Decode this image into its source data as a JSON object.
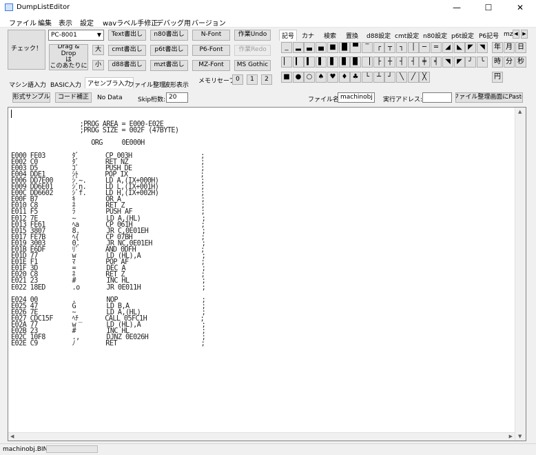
{
  "window": {
    "title": "DumpListEditor",
    "minimize": "—",
    "maximize": "☐",
    "close": "✕"
  },
  "menu": [
    "ファイル",
    "編集",
    "表示",
    "設定",
    "wavラベル手修正",
    "デバッグ用",
    "バージョン"
  ],
  "toolbar": {
    "check": "チェック！",
    "machine_select": "PC-8001",
    "drag_drop": "Drag & Drop\nは\nこのあたりに",
    "size_large": "大",
    "size_small": "小",
    "text_out": "Text書出し",
    "cmt_out": "cmt書出し",
    "d88_out": "d88書出し",
    "n80_out": "n80書出し",
    "p6t_out": "p6t書出し",
    "mzt_out": "mzt書出し",
    "n_font": "N-Font",
    "p6_font": "P6-Font",
    "mz_font": "MZ-Font",
    "undo": "作業Undo",
    "redo": "作業Redo",
    "ms_gothic": "MS Gothic"
  },
  "left_tabs": [
    "マシン語入力",
    "BASIC入力",
    "アセンブラ入力",
    "ファイル整理",
    "波形表示"
  ],
  "active_left_tab": "アセンブラ入力",
  "memory_save": {
    "label": "メモリセーブ:",
    "slots": [
      "0",
      "1",
      "2"
    ]
  },
  "right_tabs": [
    "記号",
    "カナ",
    "検索",
    "置換",
    "d88設定",
    "cmt設定",
    "n80設定",
    "p6t設定",
    "P6記号",
    "mz"
  ],
  "active_right_tab": "記号",
  "symbol_rows": [
    [
      "_",
      "▂",
      "▃",
      "▄",
      "■",
      "█",
      "▀",
      "‾",
      "┌",
      "┬",
      "┐",
      "│",
      "─",
      "═",
      "◢",
      "◣",
      "◤",
      "◥"
    ],
    [
      "▏",
      "▎",
      "▍",
      "▌",
      "▋",
      "▊",
      "▉",
      "▕",
      "├",
      "┼",
      "┤",
      "┤",
      "╪",
      "╡",
      "◥",
      "◤",
      "╯",
      "╰"
    ],
    [
      "■",
      "●",
      "○",
      "♠",
      "♥",
      "♦",
      "♣",
      "└",
      "┴",
      "┘",
      "╲",
      "╱",
      "╳"
    ]
  ],
  "kanji_rows": [
    [
      "年",
      "月",
      "日"
    ],
    [
      "時",
      "分",
      "秒"
    ],
    [
      "円"
    ]
  ],
  "options": {
    "format_sample": "形式サンプル",
    "code_fix": "コード補正",
    "no_data": "No Data",
    "skip_label": "Skip桁数:",
    "skip_value": "20",
    "filename_label": "ファイル名:",
    "filename_value": "machinobj",
    "exec_label": "実行アドレス:",
    "exec_value": "",
    "paste_button": "ファイル整理画面にPaste"
  },
  "code_lines": [
    "",
    "                  ;PROG AREA = E000-E02E",
    "                  ;PROG SIZE = 002F (47BYTE)",
    "",
    "                     ORG     0E000H",
    "",
    "E000 FE03       ﾀﾞ       CP 003H                  ;",
    "E002 C0         ﾀﾞ       RET NZ                   ;",
    "E003 D5         ｺﾞ       PUSH DE                  ;",
    "E004 DDE1       ｼﾄ       POP IX                   ;",
    "E006 DD7E00     ｼﾞ~.     LD A,(IX+000H)           ;",
    "E009 DD6E01     ｼﾞn.     LD L,(IX+001H)           ;",
    "E00C DD6602     ｼﾞf.     LD H,(IX+002H)           ;",
    "E00F B7         ｷ        OR A                     ;",
    "E010 C8         ﾈ        RET Z                    ;",
    "E011 F5         ﾗ        PUSH AF                  ;",
    "E012 7E         ~        LD A,(HL)                ;",
    "E013 FE61       ﾍa       CP 061H                  ;",
    "E015 3807       8.       JR C,0E01EH              ;",
    "E017 FE7B       ﾍ{       CP 07BH                  ;",
    "E019 3003       0.       JR NC,0E01EH             ;",
    "E01B E6DF       ﾘﾟ       AND 0DFH                 ;",
    "E01D 77         w        LD (HL),A                ;",
    "E01E F1         ﾏ        POP AF                   ;",
    "E01F 3D         =        DEC A                    ;",
    "E020 C8         ﾈ        RET Z                    ;",
    "E021 23         #        INC HL                   ;",
    "E022 18ED       .o       JR 0E011H                ;",
    "",
    "E024 00         .        NOP                      ;",
    "E025 47         G        LD B,A                   ;",
    "E026 7E         ~        LD A,(HL)                ;",
    "E027 CDC15F     ﾍﾁ_      CALL 05FC1H              ;",
    "E02A 77         w        LD (HL),A                ;",
    "E02B 23         #        INC HL                   ;",
    "E02C 10F8       .,       DJNZ 0E026H              ;",
    "E02E C9         ﾉ        RET                      ;"
  ],
  "status": {
    "filename": "machinobj.BIN"
  }
}
